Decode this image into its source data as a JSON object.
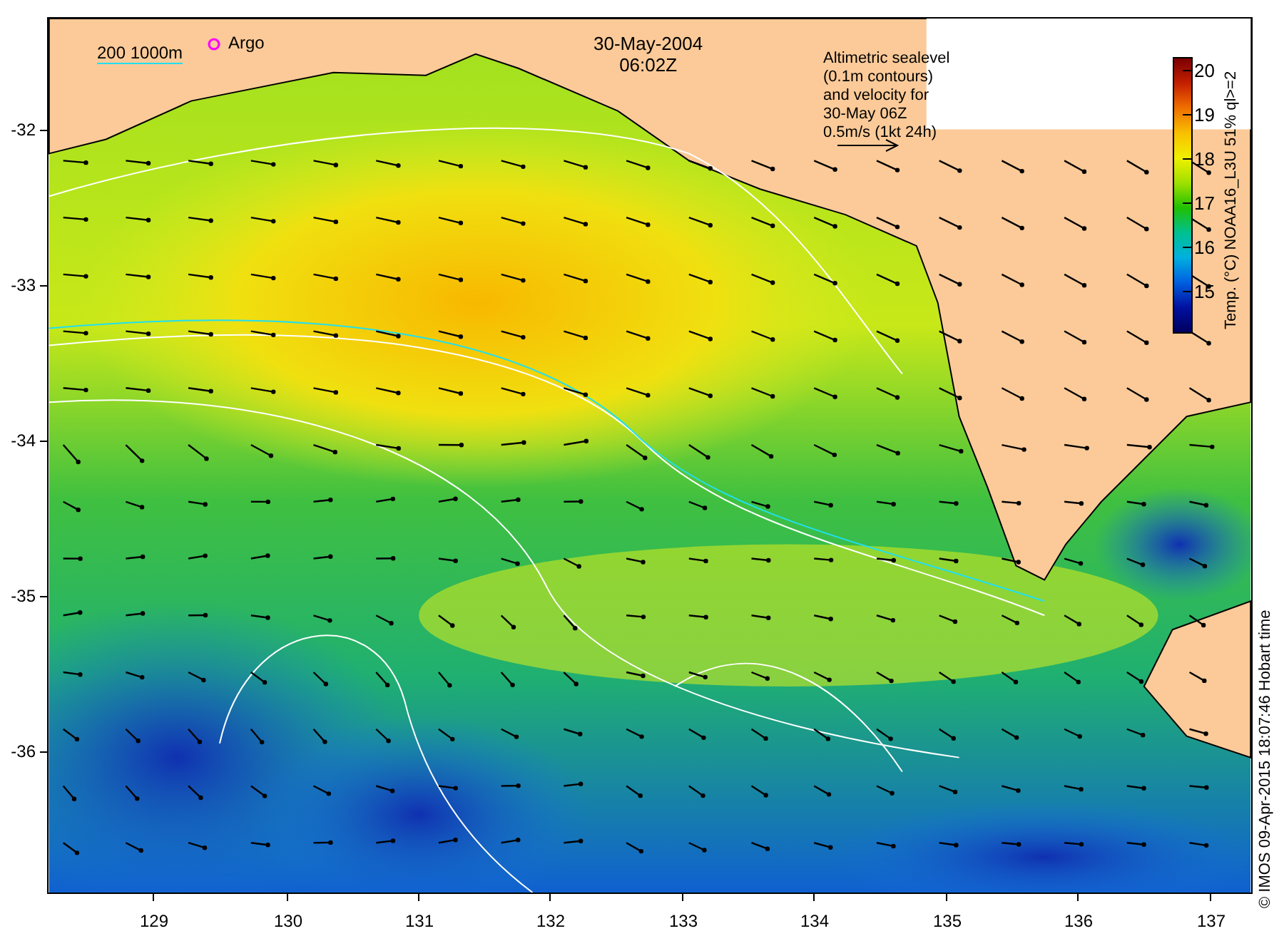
{
  "map": {
    "title": "30-May-2004",
    "time": "06:02Z",
    "scale_label": "200  1000m",
    "argo_label": "Argo",
    "legend_lines": [
      "Altimetric sealevel",
      "(0.1m contours)",
      "and velocity for",
      "30-May 06Z",
      "0.5m/s (1kt 24h)"
    ],
    "colorbar": {
      "label": "Temp. (°C) NOAA16_L3U 51% ql>=2",
      "ticks": [
        "20",
        "19",
        "18",
        "17",
        "16",
        "15"
      ]
    },
    "y_ticks": [
      "-32",
      "-33",
      "-34",
      "-35",
      "-36"
    ],
    "x_ticks": [
      "129",
      "130",
      "131",
      "132",
      "133",
      "134",
      "135",
      "136",
      "137"
    ]
  },
  "credit": "© IMOS 09-Apr-2015 18:07:46 Hobart time"
}
